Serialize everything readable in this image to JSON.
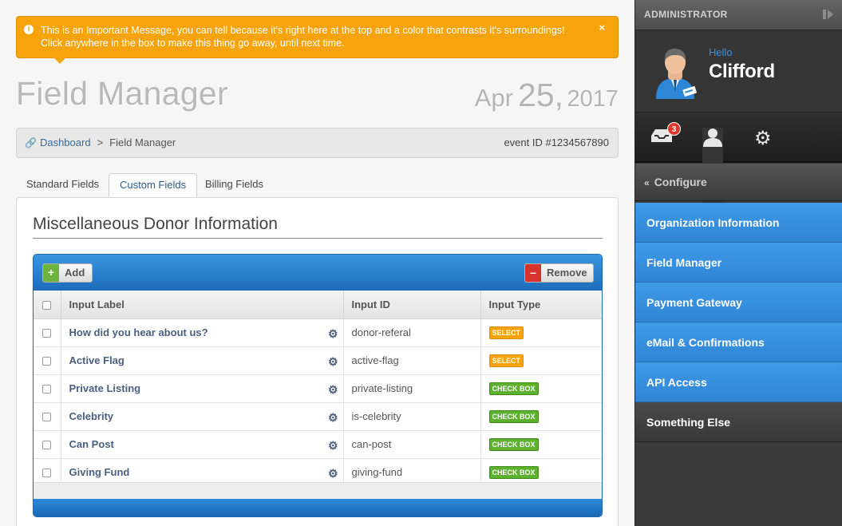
{
  "alert": {
    "text": "This is an Important Message, you can tell because it's right here at the top and a color that contrasts it's surroundings! Click anywhere in the box to make this thing go away, until next time.",
    "close": "×",
    "color": "#f7a30b"
  },
  "page": {
    "title": "Field Manager",
    "date_month": "Apr",
    "date_day": "25,",
    "date_year": "2017"
  },
  "breadcrumb": {
    "home": "Dashboard",
    "separator": ">",
    "current": "Field Manager",
    "event_id": "event ID #1234567890"
  },
  "tabs": [
    "Standard Fields",
    "Custom Fields",
    "Billing Fields"
  ],
  "panel": {
    "heading": "Miscellaneous Donor Information",
    "add_label": "Add",
    "remove_label": "Remove",
    "columns": [
      "Input Label",
      "Input ID",
      "Input Type"
    ],
    "rows": [
      {
        "label": "How did you hear about us?",
        "id": "donor-referal",
        "type": "SELECT",
        "kind": "select"
      },
      {
        "label": "Active Flag",
        "id": "active-flag",
        "type": "SELECT",
        "kind": "select"
      },
      {
        "label": "Private Listing",
        "id": "private-listing",
        "type": "CHECK BOX",
        "kind": "checkbox"
      },
      {
        "label": "Celebrity",
        "id": "is-celebrity",
        "type": "CHECK BOX",
        "kind": "checkbox"
      },
      {
        "label": "Can Post",
        "id": "can-post",
        "type": "CHECK BOX",
        "kind": "checkbox"
      },
      {
        "label": "Giving Fund",
        "id": "giving-fund",
        "type": "CHECK BOX",
        "kind": "checkbox"
      }
    ]
  },
  "sidebar": {
    "header": "ADMINISTRATOR",
    "hello": "Hello",
    "username": "Clifford",
    "notification_count": "3",
    "configure": "Configure",
    "menu": [
      {
        "label": "Organization Information",
        "style": "blue"
      },
      {
        "label": "Field Manager",
        "style": "blue"
      },
      {
        "label": "Payment Gateway",
        "style": "blue"
      },
      {
        "label": "eMail & Confirmations",
        "style": "blue"
      },
      {
        "label": "API Access",
        "style": "blue"
      },
      {
        "label": "Something Else",
        "style": "dark"
      }
    ],
    "accent_color": "#3f9ae8"
  }
}
